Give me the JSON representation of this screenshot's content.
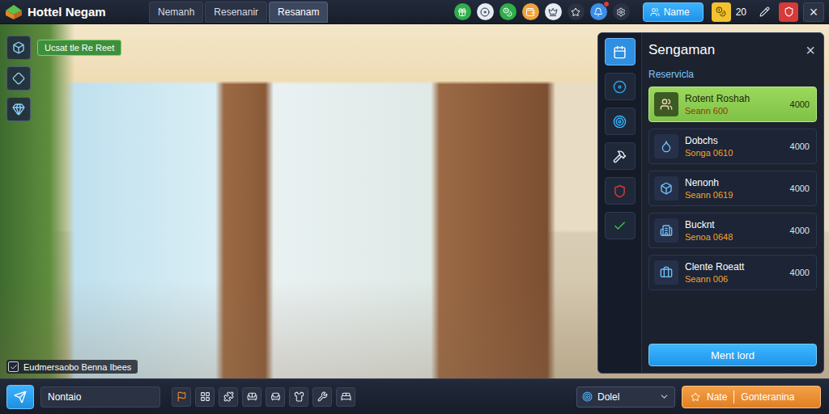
{
  "app": {
    "title": "Hottel Negam"
  },
  "tabs": [
    {
      "label": "Nemanh",
      "selected": false
    },
    {
      "label": "Resenanir",
      "selected": false
    },
    {
      "label": "Resanam",
      "selected": true
    }
  ],
  "top_bar": {
    "button": "Name",
    "count": "20",
    "close": "×",
    "alert": true
  },
  "left_badge": "Ucsat tle Re Reet",
  "checkbox": {
    "label": "Eudmersaobo Benna Ibees",
    "checked": true
  },
  "panel": {
    "title": "Sengaman",
    "close": "×",
    "section": "Reservicla",
    "rail": [
      {
        "selected": true,
        "color": "#2f8fe0"
      },
      {
        "selected": false,
        "color": "#2aa6ee"
      },
      {
        "selected": false,
        "color": "#35b4ff"
      },
      {
        "selected": false,
        "color": "#dfe6ef"
      },
      {
        "selected": false,
        "color": "#d83a3a"
      },
      {
        "selected": false,
        "color": "#37c24a"
      }
    ],
    "items": [
      {
        "name": "Rotent Roshah",
        "sub": "Seann 600",
        "price": "4000",
        "selected": true
      },
      {
        "name": "Dobchs",
        "sub": "Songa 0610",
        "price": "4000",
        "selected": false
      },
      {
        "name": "Nenonh",
        "sub": "Seann 0619",
        "price": "4000",
        "selected": false
      },
      {
        "name": "Bucknt",
        "sub": "Senoa 0648",
        "price": "4000",
        "selected": false
      },
      {
        "name": "Clente Roeatt",
        "sub": "Seann 006",
        "price": "4000",
        "selected": false
      }
    ],
    "button": "Ment lord"
  },
  "bottom_bar": {
    "field": "Nontaio",
    "dropdown": "Dolel",
    "action": {
      "label": "Nate",
      "value": "Gonteranina"
    }
  }
}
